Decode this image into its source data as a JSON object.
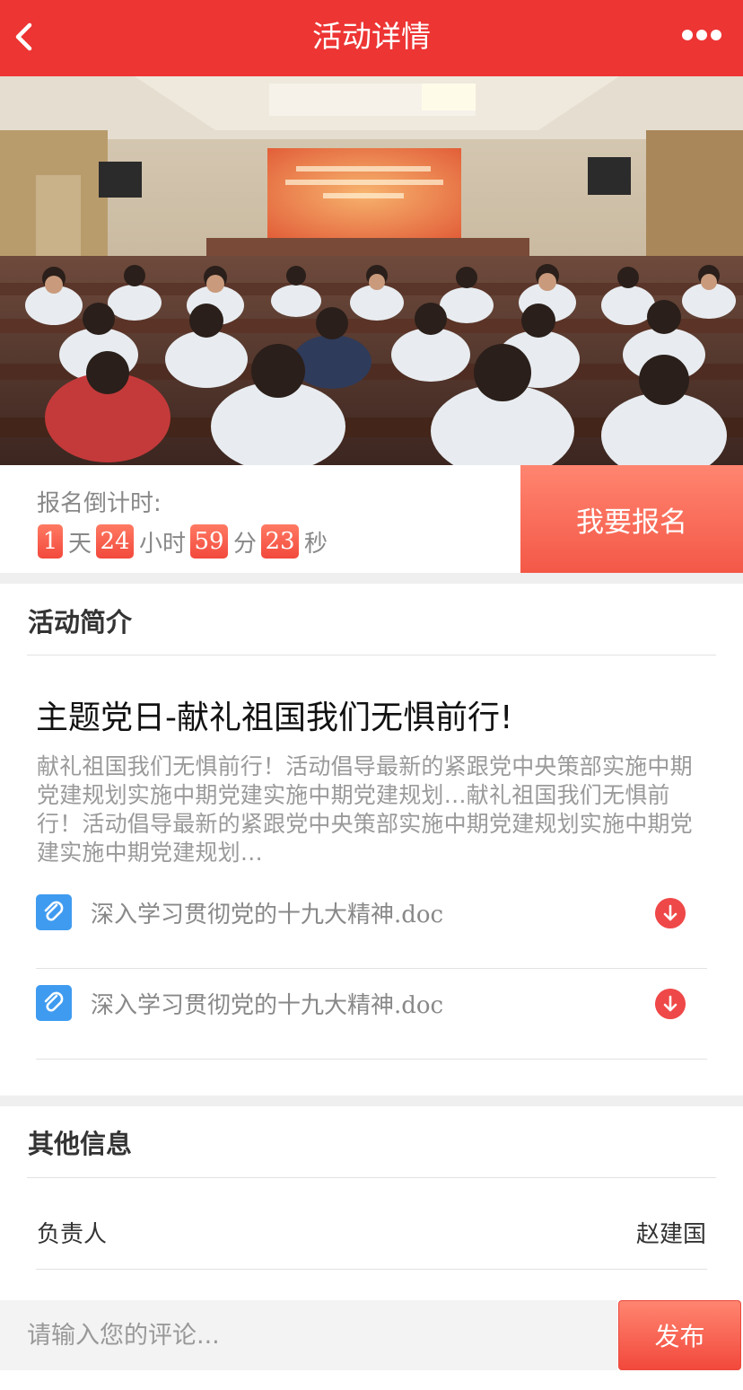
{
  "header": {
    "title": "活动详情"
  },
  "countdown": {
    "label": "报名倒计时:",
    "days": "1",
    "days_unit": "天",
    "hours": "24",
    "hours_unit": "小时",
    "minutes": "59",
    "minutes_unit": "分",
    "seconds": "23",
    "seconds_unit": "秒"
  },
  "signup_button": "我要报名",
  "intro": {
    "section_title": "活动简介",
    "title": "主题党日-献礼祖国我们无惧前行!",
    "description": "献礼祖国我们无惧前行！活动倡导最新的紧跟党中央策部实施中期党建规划实施中期党建实施中期党建规划…献礼祖国我们无惧前行！活动倡导最新的紧跟党中央策部实施中期党建规划实施中期党建实施中期党建规划…",
    "attachments": [
      {
        "name": "深入学习贯彻党的十九大精神.doc",
        "icon": "paperclip-icon",
        "action_icon": "download-icon"
      },
      {
        "name": "深入学习贯彻党的十九大精神.doc",
        "icon": "paperclip-icon",
        "action_icon": "download-icon"
      }
    ]
  },
  "other": {
    "section_title": "其他信息",
    "rows": [
      {
        "label": "负责人",
        "value": "赵建国"
      }
    ]
  },
  "comment": {
    "placeholder": "请输入您的评论...",
    "value": "",
    "submit": "发布"
  },
  "colors": {
    "header": "#ed3534",
    "accent": "#f45847",
    "link_icon": "#3f9bf0"
  }
}
